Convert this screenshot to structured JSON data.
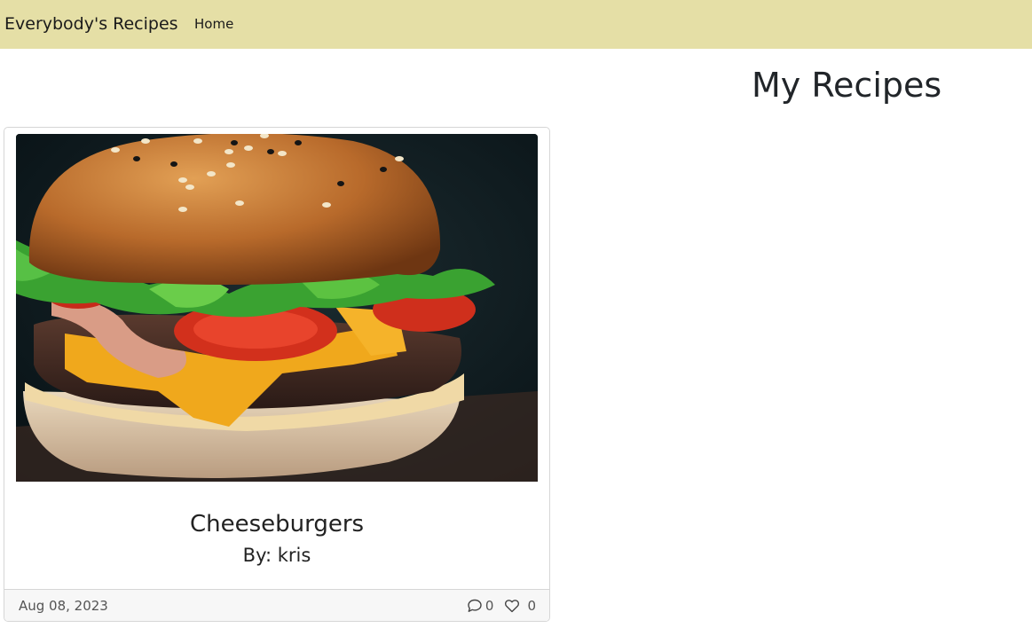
{
  "navbar": {
    "brand": "Everybody's Recipes",
    "links": [
      {
        "label": "Home"
      }
    ],
    "background_color": "#e5dfa6"
  },
  "main": {
    "title": "My Recipes"
  },
  "recipes": [
    {
      "title": "Cheeseburgers",
      "author": "By: kris",
      "image_alt": "cheeseburger",
      "date": "Aug 08, 2023",
      "comments": "0",
      "likes": "0",
      "comment_icon": "chat-bubble-icon",
      "like_icon": "heart-icon"
    }
  ]
}
